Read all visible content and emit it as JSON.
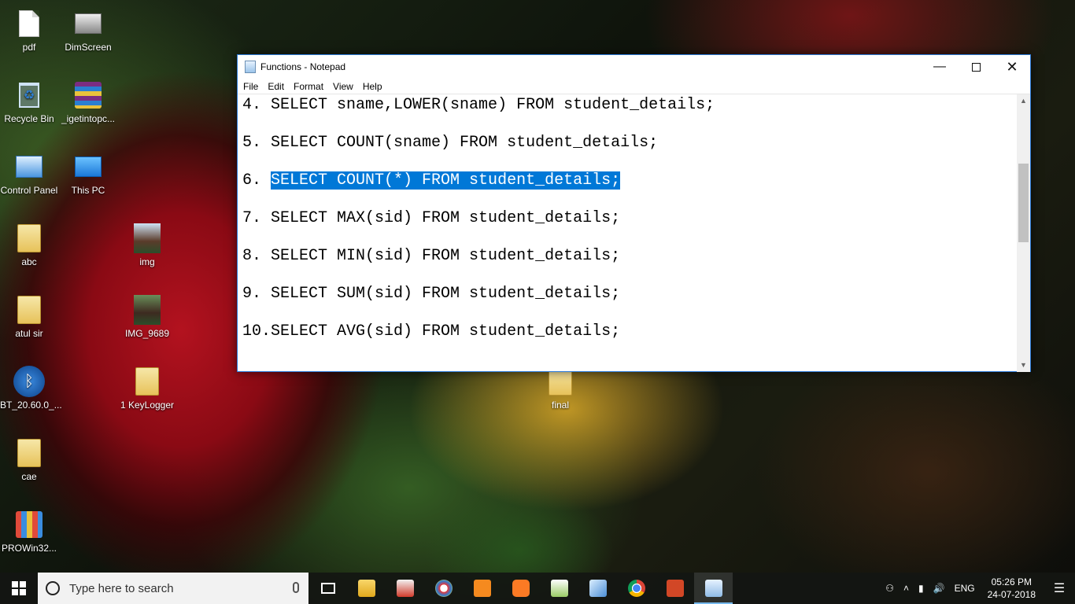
{
  "desktop": {
    "icons": [
      {
        "label": "pdf",
        "icon": "file-icon"
      },
      {
        "label": "DimScreen",
        "icon": "dimscreen-icon"
      },
      {
        "label": "Recycle Bin",
        "icon": "recycle-bin-icon"
      },
      {
        "label": "_igetintopc...",
        "icon": "winrar-icon"
      },
      {
        "label": "Control Panel",
        "icon": "control-panel-icon"
      },
      {
        "label": "This PC",
        "icon": "this-pc-icon"
      },
      {
        "label": "abc",
        "icon": "folder-icon"
      },
      {
        "label": "img",
        "icon": "photo-icon"
      },
      {
        "label": "atul sir",
        "icon": "folder-icon"
      },
      {
        "label": "IMG_9689",
        "icon": "photo-icon"
      },
      {
        "label": "BT_20.60.0_...",
        "icon": "bluetooth-icon"
      },
      {
        "label": "1 KeyLogger",
        "icon": "folder-icon"
      },
      {
        "label": "final",
        "icon": "folder-icon"
      },
      {
        "label": "cae",
        "icon": "folder-icon"
      },
      {
        "label": "PROWin32...",
        "icon": "installer-icon"
      }
    ]
  },
  "notepad": {
    "title": "Functions - Notepad",
    "menu": [
      "File",
      "Edit",
      "Format",
      "View",
      "Help"
    ],
    "lines": [
      {
        "num": "4. ",
        "text": "SELECT sname,LOWER(sname) FROM student_details;"
      },
      {
        "num": "5. ",
        "text": "SELECT COUNT(sname) FROM student_details;"
      },
      {
        "num": "6. ",
        "text": "SELECT COUNT(*) FROM student_details;"
      },
      {
        "num": "7. ",
        "text": "SELECT MAX(sid) FROM student_details;"
      },
      {
        "num": "8. ",
        "text": "SELECT MIN(sid) FROM student_details;"
      },
      {
        "num": "9. ",
        "text": "SELECT SUM(sid) FROM student_details;"
      },
      {
        "num": "10.",
        "text": "SELECT AVG(sid) FROM student_details;"
      }
    ],
    "selected_line": "6. ",
    "selection_color": "#0078d7"
  },
  "taskbar": {
    "search_placeholder": "Type here to search",
    "apps": [
      "task-view-icon",
      "file-explorer-icon",
      "media-app-icon",
      "paint-icon",
      "sublime-text-icon",
      "xampp-icon",
      "chart-app-icon",
      "box-app-icon",
      "chrome-icon",
      "powerpoint-icon",
      "notepad-icon"
    ],
    "language": "ENG",
    "time": "05:26 PM",
    "date": "24-07-2018"
  }
}
